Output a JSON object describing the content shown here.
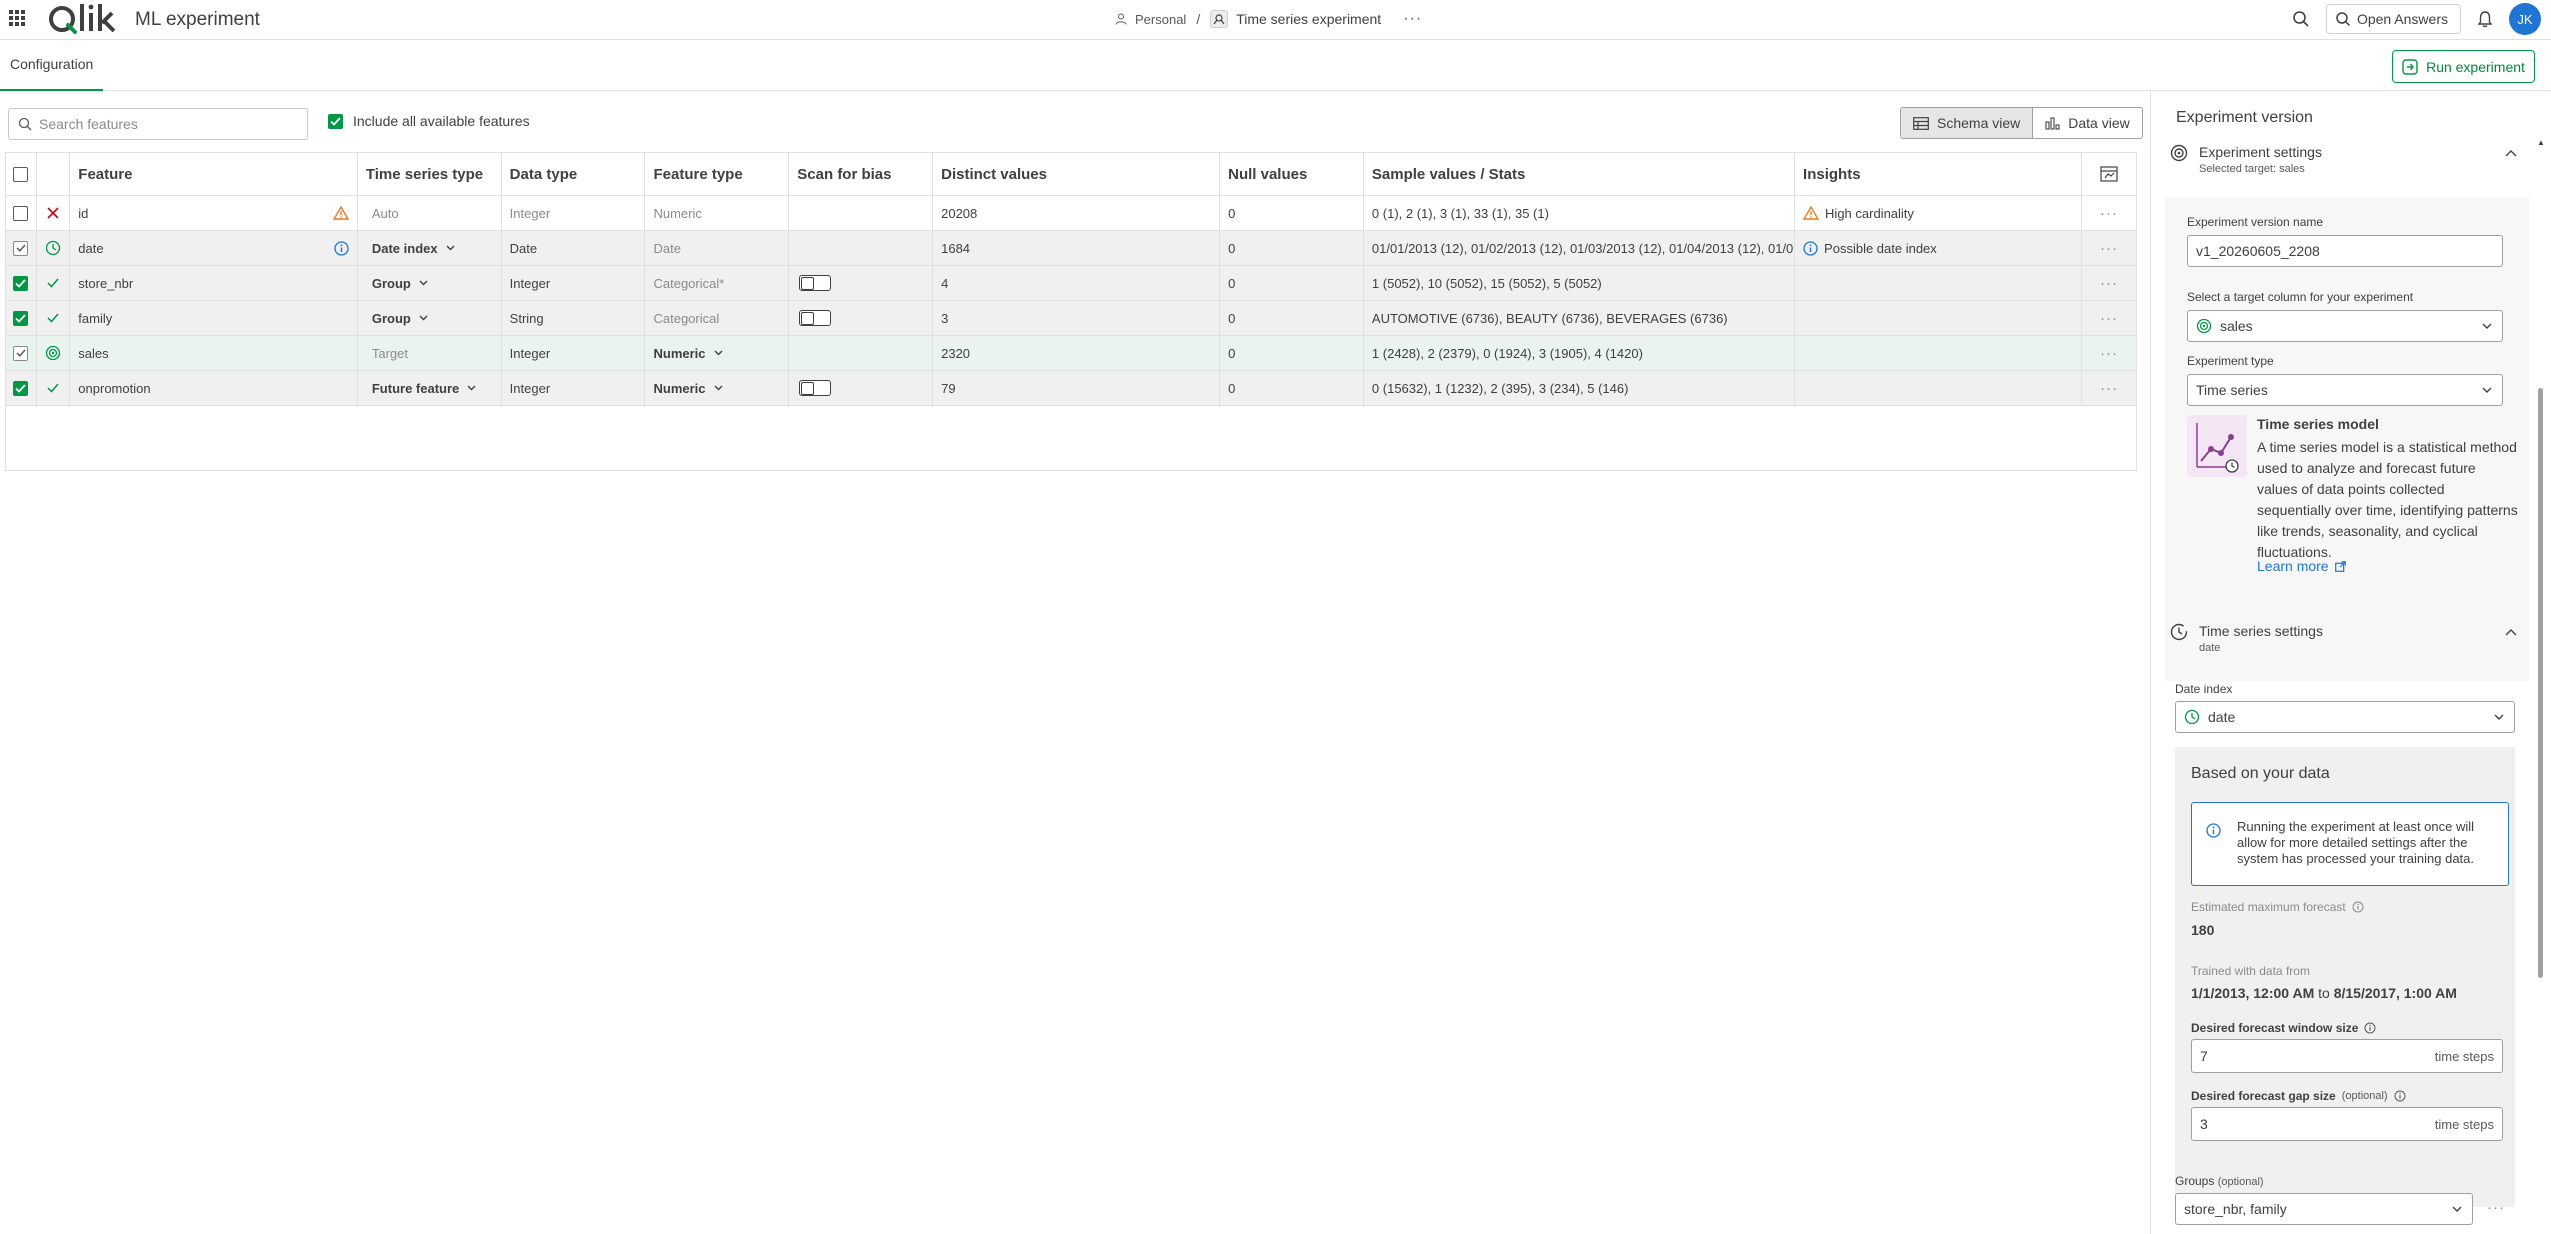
{
  "header": {
    "app_title": "ML experiment",
    "breadcrumb_space": "Personal",
    "breadcrumb_sep": "/",
    "breadcrumb_item": "Time series experiment",
    "more": "···",
    "open_answers": "Open Answers",
    "avatar_initials": "JK"
  },
  "tabs": {
    "configuration": "Configuration",
    "run_experiment": "Run experiment"
  },
  "toolbar": {
    "search_placeholder": "Search features",
    "include_all": "Include all available features",
    "schema_view": "Schema view",
    "data_view": "Data view"
  },
  "table": {
    "columns": {
      "feature": "Feature",
      "time_series_type": "Time series type",
      "data_type": "Data type",
      "feature_type": "Feature type",
      "scan_for_bias": "Scan for bias",
      "distinct_values": "Distinct values",
      "null_values": "Null values",
      "sample_values": "Sample values / Stats",
      "insights": "Insights"
    },
    "rows": [
      {
        "feature": "id",
        "ts_type": "Auto",
        "data_type": "Integer",
        "feature_type": "Numeric",
        "distinct": "20208",
        "nulls": "0",
        "sample": "0 (1), 2 (1), 3 (1), 33 (1), 35 (1)",
        "insight": "High cardinality",
        "more": "···"
      },
      {
        "feature": "date",
        "ts_type": "Date index",
        "data_type": "Date",
        "feature_type": "Date",
        "distinct": "1684",
        "nulls": "0",
        "sample": "01/01/2013 (12), 01/02/2013 (12), 01/03/2013 (12), 01/04/2013 (12), 01/05/...",
        "insight": "Possible date index",
        "more": "···"
      },
      {
        "feature": "store_nbr",
        "ts_type": "Group",
        "data_type": "Integer",
        "feature_type": "Categorical*",
        "distinct": "4",
        "nulls": "0",
        "sample": "1 (5052), 10 (5052), 15 (5052), 5 (5052)",
        "insight": "",
        "more": "···"
      },
      {
        "feature": "family",
        "ts_type": "Group",
        "data_type": "String",
        "feature_type": "Categorical",
        "distinct": "3",
        "nulls": "0",
        "sample": "AUTOMOTIVE (6736), BEAUTY (6736), BEVERAGES (6736)",
        "insight": "",
        "more": "···"
      },
      {
        "feature": "sales",
        "ts_type": "Target",
        "data_type": "Integer",
        "feature_type": "Numeric",
        "distinct": "2320",
        "nulls": "0",
        "sample": "1 (2428), 2 (2379), 0 (1924), 3 (1905), 4 (1420)",
        "insight": "",
        "more": "···"
      },
      {
        "feature": "onpromotion",
        "ts_type": "Future feature",
        "data_type": "Integer",
        "feature_type": "Numeric",
        "distinct": "79",
        "nulls": "0",
        "sample": "0 (15632), 1 (1232), 2 (395), 3 (234), 5 (146)",
        "insight": "",
        "more": "···"
      }
    ]
  },
  "panel": {
    "title": "Experiment version",
    "experiment_settings": {
      "title": "Experiment settings",
      "subtitle": "Selected target: sales",
      "version_name_label": "Experiment version name",
      "version_name_value": "v1_20260605_2208",
      "target_label": "Select a target column for your experiment",
      "target_value": "sales",
      "type_label": "Experiment type",
      "type_value": "Time series",
      "model_title": "Time series model",
      "model_desc": "A time series model is a statistical method used to analyze and forecast future values of data points collected sequentially over time, identifying patterns like trends, seasonality, and cyclical fluctuations.",
      "learn_more": "Learn more"
    },
    "time_series_settings": {
      "title": "Time series settings",
      "subtitle": "date",
      "date_index_label": "Date index",
      "date_index_value": "date",
      "based_on_data": "Based on your data",
      "info": "Running the experiment at least once will allow for more detailed settings after the system has processed your training data.",
      "est_max_label": "Estimated maximum forecast",
      "est_max_value": "180",
      "trained_label": "Trained with data from",
      "trained_from": "1/1/2013, 12:00 AM",
      "trained_to_word": "to",
      "trained_to": "8/15/2017, 1:00 AM",
      "window_label": "Desired forecast window size",
      "window_value": "7",
      "gap_label": "Desired forecast gap size",
      "optional": "(optional)",
      "gap_value": "3",
      "unit": "time steps",
      "groups_label": "Groups",
      "groups_value": "store_nbr, family"
    }
  },
  "colors": {
    "accent_green": "#009845",
    "info_blue": "#1f75d1",
    "warning_orange": "#ee7a1e",
    "error_red": "#d0021b"
  }
}
